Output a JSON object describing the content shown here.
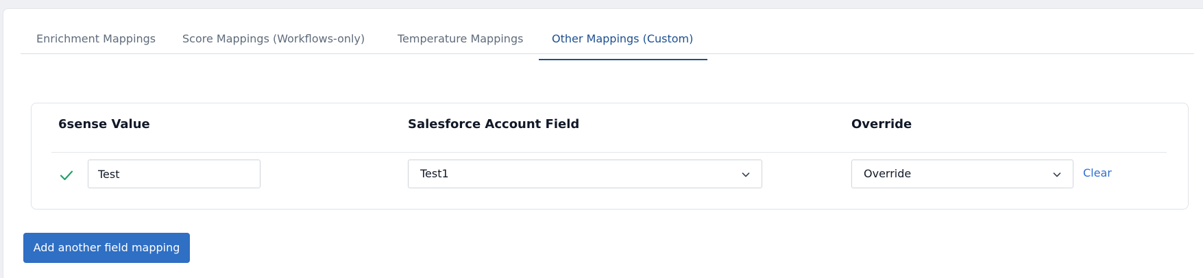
{
  "tabs": [
    {
      "label": "Enrichment Mappings",
      "active": false
    },
    {
      "label": "Score Mappings (Workflows-only)",
      "active": false
    },
    {
      "label": "Temperature Mappings",
      "active": false
    },
    {
      "label": "Other Mappings (Custom)",
      "active": true
    }
  ],
  "table": {
    "headers": {
      "sixsense_value": "6sense Value",
      "salesforce_field": "Salesforce Account Field",
      "override": "Override"
    },
    "rows": [
      {
        "status_icon": "check-icon",
        "sixsense_value": "Test",
        "salesforce_field": "Test1",
        "override": "Override",
        "clear_label": "Clear"
      }
    ]
  },
  "actions": {
    "add_mapping_label": "Add another field mapping"
  },
  "colors": {
    "accent": "#1d4f91",
    "link": "#2f6fd0",
    "button": "#2f6fc4",
    "success": "#22a06b"
  }
}
